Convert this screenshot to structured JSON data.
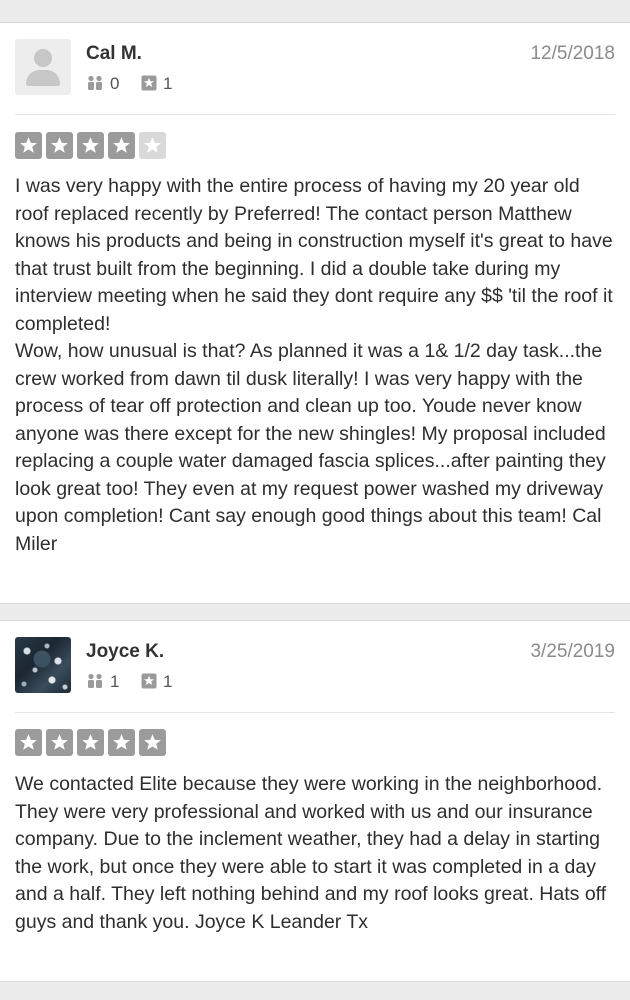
{
  "reviews": [
    {
      "name": "Cal M.",
      "date": "12/5/2018",
      "friends": "0",
      "review_count": "1",
      "rating": 4,
      "avatar": "default-person-icon",
      "text_lines": [
        "I was very happy with the entire process of having my 20 year old roof replaced recently by Preferred! The contact person Matthew knows his products and being in construction myself it's great to have that trust built from the beginning. I did a double take during my interview meeting when he said they dont require any $$ 'til the roof it completed!",
        "Wow, how unusual is that? As planned it was a 1& 1/2 day task...the crew worked from dawn til dusk literally! I was  very happy with the  process of tear off protection and clean up too. Youde never know anyone was there except for the new shingles! My proposal included replacing a couple water damaged fascia splices...after painting they look great too! They even at my request power washed my driveway upon completion! Cant say enough good things about this team! Cal Miler"
      ]
    },
    {
      "name": "Joyce K.",
      "date": "3/25/2019",
      "friends": "1",
      "review_count": "1",
      "rating": 5,
      "avatar": "user-photo",
      "text_lines": [
        "We contacted Elite because they were working in the neighborhood. They were very professional and worked with us and our insurance company. Due to the inclement weather, they had a delay in starting the work, but once they were able to start it was completed in a day and a half. They left nothing behind and my roof looks great. Hats off guys and thank you. Joyce K   Leander Tx"
      ]
    }
  ],
  "icons": {
    "friends": "friends-icon",
    "reviews": "review-star-icon",
    "star": "star-icon"
  },
  "colors": {
    "star_filled": "#9b9b9b",
    "star_empty": "#d9d9d9",
    "text": "#2e2e2e",
    "date": "#8a8a8a"
  }
}
